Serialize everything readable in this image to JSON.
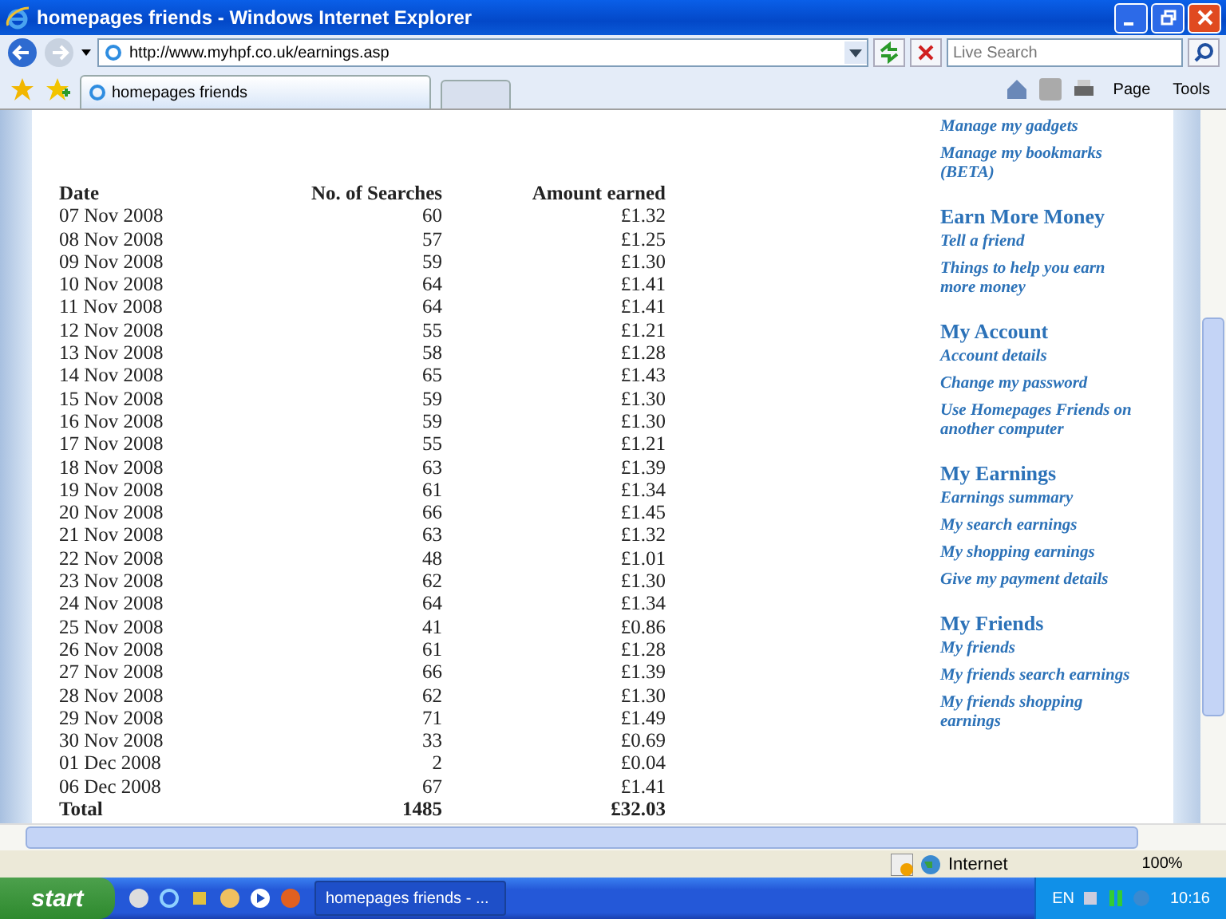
{
  "window": {
    "title": "homepages friends - Windows Internet Explorer"
  },
  "address_bar": {
    "url": "http://www.myhpf.co.uk/earnings.asp",
    "search_placeholder": "Live Search"
  },
  "tabs": [
    {
      "label": "homepages friends",
      "selected": true
    }
  ],
  "command_bar": [
    "Page",
    "Tools"
  ],
  "table": {
    "columns": [
      "Date",
      "No. of Searches",
      "Amount earned"
    ],
    "rows": [
      [
        "07 Nov 2008",
        "60",
        "£1.32"
      ],
      [
        "08 Nov 2008",
        "57",
        "£1.25"
      ],
      [
        "09 Nov 2008",
        "59",
        "£1.30"
      ],
      [
        "10 Nov 2008",
        "64",
        "£1.41"
      ],
      [
        "11 Nov 2008",
        "64",
        "£1.41"
      ],
      [
        "12 Nov 2008",
        "55",
        "£1.21"
      ],
      [
        "13 Nov 2008",
        "58",
        "£1.28"
      ],
      [
        "14 Nov 2008",
        "65",
        "£1.43"
      ],
      [
        "15 Nov 2008",
        "59",
        "£1.30"
      ],
      [
        "16 Nov 2008",
        "59",
        "£1.30"
      ],
      [
        "17 Nov 2008",
        "55",
        "£1.21"
      ],
      [
        "18 Nov 2008",
        "63",
        "£1.39"
      ],
      [
        "19 Nov 2008",
        "61",
        "£1.34"
      ],
      [
        "20 Nov 2008",
        "66",
        "£1.45"
      ],
      [
        "21 Nov 2008",
        "63",
        "£1.32"
      ],
      [
        "22 Nov 2008",
        "48",
        "£1.01"
      ],
      [
        "23 Nov 2008",
        "62",
        "£1.30"
      ],
      [
        "24 Nov 2008",
        "64",
        "£1.34"
      ],
      [
        "25 Nov 2008",
        "41",
        "£0.86"
      ],
      [
        "26 Nov 2008",
        "61",
        "£1.28"
      ],
      [
        "27 Nov 2008",
        "66",
        "£1.39"
      ],
      [
        "28 Nov 2008",
        "62",
        "£1.30"
      ],
      [
        "29 Nov 2008",
        "71",
        "£1.49"
      ],
      [
        "30 Nov 2008",
        "33",
        "£0.69"
      ],
      [
        "01 Dec 2008",
        "2",
        "£0.04"
      ],
      [
        "06 Dec 2008",
        "67",
        "£1.41"
      ]
    ],
    "total": [
      "Total",
      "1485",
      "£32.03"
    ]
  },
  "sidebar": [
    {
      "links": [
        "Manage my gadgets",
        "Manage my bookmarks (BETA)"
      ]
    },
    {
      "heading": "Earn More Money",
      "links": [
        "Tell a friend",
        "Things to help you earn more money"
      ]
    },
    {
      "heading": "My Account",
      "links": [
        "Account details",
        "Change my password",
        "Use Homepages Friends on another computer"
      ]
    },
    {
      "heading": "My Earnings",
      "links": [
        "Earnings summary",
        "My search earnings",
        "My shopping earnings",
        "Give my payment details"
      ]
    },
    {
      "heading": "My Friends",
      "links": [
        "My friends",
        "My friends search earnings",
        "My friends shopping earnings"
      ]
    }
  ],
  "status_bar": {
    "zone": "Internet",
    "zoom": "100%"
  },
  "taskbar": {
    "start": "start",
    "task": "homepages friends - ...",
    "language": "EN",
    "clock": "10:16"
  }
}
